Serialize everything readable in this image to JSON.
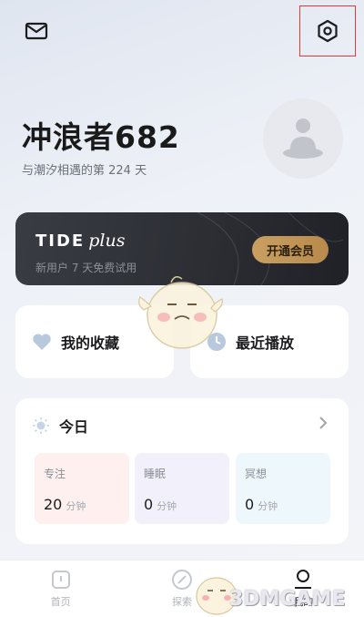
{
  "header": {
    "mail_icon": "mail-icon",
    "settings_icon": "settings-icon"
  },
  "profile": {
    "username": "冲浪者682",
    "days_text": "与潮汐相遇的第 224 天",
    "avatar_icon": "meditation-avatar"
  },
  "tide_plus": {
    "brand": "TIDE",
    "brand_suffix": "plus",
    "subtitle": "新用户 7 天免费试用",
    "button": "开通会员"
  },
  "quick": {
    "favorites": "我的收藏",
    "recent": "最近播放"
  },
  "today": {
    "title": "今日",
    "stats": [
      {
        "label": "专注",
        "value": "20",
        "unit": "分钟"
      },
      {
        "label": "睡眠",
        "value": "0",
        "unit": "分钟"
      },
      {
        "label": "冥想",
        "value": "0",
        "unit": "分钟"
      }
    ]
  },
  "tabs": [
    {
      "label": "首页"
    },
    {
      "label": "探索"
    },
    {
      "label": "我的"
    }
  ],
  "watermark": "3DMGAME",
  "colors": {
    "accent_gold": "#c9a062",
    "dark_card": "#2b2d33",
    "highlight_box": "#e53935"
  }
}
